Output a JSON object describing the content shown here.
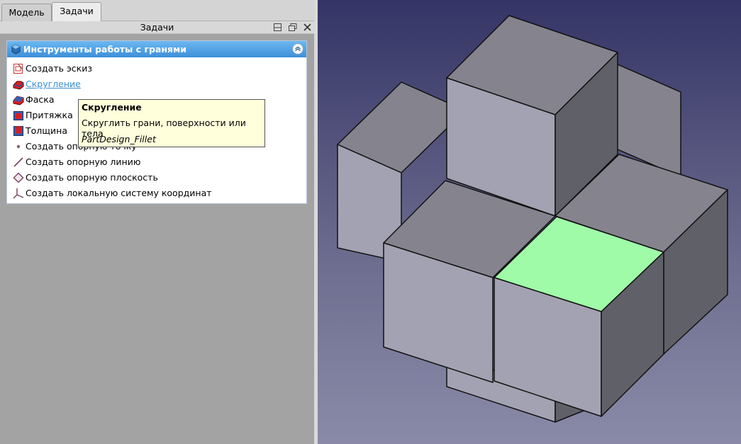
{
  "tabs": [
    {
      "label": "Модель",
      "active": false
    },
    {
      "label": "Задачи",
      "active": true
    }
  ],
  "panel": {
    "title": "Задачи",
    "buttons": [
      "float-icon",
      "restore-icon",
      "close-icon"
    ]
  },
  "taskbox": {
    "title": "Инструменты работы с гранями",
    "items": [
      {
        "label": "Создать эскиз",
        "icon": "sketch-icon"
      },
      {
        "label": "Скругление",
        "icon": "fillet-icon",
        "hovered": true
      },
      {
        "label": "Фаска",
        "icon": "chamfer-icon"
      },
      {
        "label": "Притяжка",
        "icon": "draft-icon"
      },
      {
        "label": "Толщина",
        "icon": "thickness-icon"
      },
      {
        "label": "Создать опорную точку",
        "icon": "datum-point-icon"
      },
      {
        "label": "Создать опорную линию",
        "icon": "datum-line-icon"
      },
      {
        "label": "Создать опорную плоскость",
        "icon": "datum-plane-icon"
      },
      {
        "label": "Создать локальную систему координат",
        "icon": "local-cs-icon"
      }
    ]
  },
  "tooltip": {
    "title": "Скругление",
    "description": "Скруглить грани, поверхности или тела",
    "command": "PartDesign_Fillet"
  },
  "colors": {
    "header_blue": "#3d8fd8",
    "selected_face": "#a0fba8",
    "box_front": "#a3a2b2",
    "box_top": "#84838e",
    "box_side": "#606068"
  }
}
